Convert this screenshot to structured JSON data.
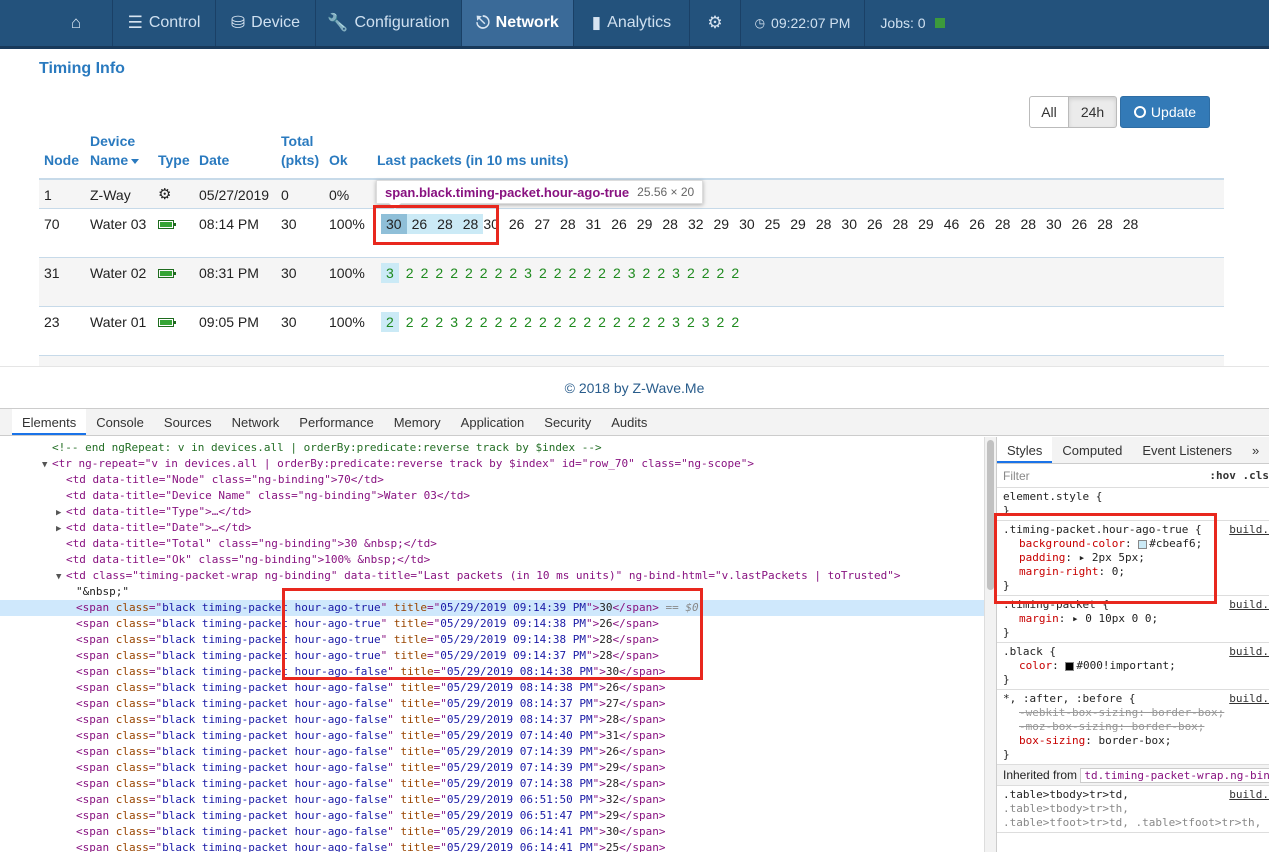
{
  "nav": {
    "items": [
      {
        "icon": "home-icon",
        "label": ""
      },
      {
        "icon": "sliders-icon",
        "label": "Control"
      },
      {
        "icon": "database-icon",
        "label": "Device"
      },
      {
        "icon": "wrench-icon",
        "label": "Configuration"
      },
      {
        "icon": "sitemap-icon",
        "label": "Network"
      },
      {
        "icon": "bar-chart-icon",
        "label": "Analytics"
      },
      {
        "icon": "gear-icon",
        "label": ""
      }
    ],
    "clock": "09:22:07 PM",
    "jobs": "Jobs: 0",
    "accent": "#23527c"
  },
  "page": {
    "title": "Timing Info",
    "filters": {
      "all": "All",
      "h24": "24h",
      "update": "Update"
    }
  },
  "table": {
    "headers": {
      "node": "Node",
      "device_name_1": "Device",
      "device_name_2": "Name",
      "type": "Type",
      "date": "Date",
      "total_1": "Total",
      "total_2": "(pkts)",
      "ok": "Ok",
      "last": "Last packets (in 10 ms units)"
    },
    "rows": [
      {
        "node": "1",
        "name": "Z-Way",
        "date": "05/27/2019",
        "total": "0",
        "ok": "0%"
      },
      {
        "node": "70",
        "name": "Water 03",
        "date": "08:14 PM",
        "total": "30",
        "ok": "100%"
      },
      {
        "node": "31",
        "name": "Water 02",
        "date": "08:31 PM",
        "total": "30",
        "ok": "100%"
      },
      {
        "node": "23",
        "name": "Water 01",
        "date": "09:05 PM",
        "total": "30",
        "ok": "100%"
      }
    ],
    "packets_70_hl": [
      "30",
      "26",
      "28",
      "28"
    ],
    "packets_70": [
      "30",
      "26",
      "27",
      "28",
      "31",
      "26",
      "29",
      "28",
      "32",
      "29",
      "30",
      "25",
      "29",
      "28",
      "30",
      "26",
      "28",
      "29",
      "46",
      "26",
      "28",
      "28",
      "30",
      "26",
      "28",
      "28"
    ],
    "packets_31_hl": [
      "3"
    ],
    "packets_31": [
      "2",
      "2",
      "2",
      "2",
      "2",
      "2",
      "2",
      "2",
      "3",
      "2",
      "2",
      "2",
      "2",
      "2",
      "2",
      "3",
      "2",
      "2",
      "3",
      "2",
      "2",
      "2",
      "2"
    ],
    "packets_23_hl": [
      "2"
    ],
    "packets_23": [
      "2",
      "2",
      "2",
      "3",
      "2",
      "2",
      "2",
      "2",
      "2",
      "2",
      "2",
      "2",
      "2",
      "2",
      "2",
      "2",
      "2",
      "2",
      "3",
      "2",
      "3",
      "2",
      "2"
    ]
  },
  "tooltip": {
    "selector": "span.black.timing-packet.hour-ago-true",
    "size": "25.56 × 20"
  },
  "footer": "© 2018 by Z-Wave.Me",
  "devtools": {
    "tabs": [
      "Elements",
      "Console",
      "Sources",
      "Network",
      "Performance",
      "Memory",
      "Application",
      "Security",
      "Audits"
    ],
    "comment": "<!-- end ngRepeat: v in devices.all | orderBy:predicate:reverse track by $index -->",
    "tr_open": "<tr ng-repeat=\"v in devices.all | orderBy:predicate:reverse track by $index\" id=\"row_70\" class=\"ng-scope\">",
    "td_lines": [
      "<td data-title=\"Node\" class=\"ng-binding\">70</td>",
      "<td data-title=\"Device Name\" class=\"ng-binding\">Water 03</td>",
      "<td data-title=\"Type\">…</td>",
      "<td data-title=\"Date\">…</td>",
      "<td data-title=\"Total\" class=\"ng-binding\">30 &nbsp;</td>",
      "<td data-title=\"Ok\" class=\"ng-binding\">100% &nbsp;</td>",
      "<td class=\"timing-packet-wrap ng-binding\" data-title=\"Last packets (in 10 ms units)\" ng-bind-html=\"v.lastPackets | toTrusted\">",
      "\"&nbsp;\""
    ],
    "spans": [
      {
        "cls": "black timing-packet hour-ago-true",
        "title": "05/29/2019 09:14:39 PM",
        "val": "30"
      },
      {
        "cls": "black timing-packet hour-ago-true",
        "title": "05/29/2019 09:14:38 PM",
        "val": "26"
      },
      {
        "cls": "black timing-packet hour-ago-true",
        "title": "05/29/2019 09:14:38 PM",
        "val": "28"
      },
      {
        "cls": "black timing-packet hour-ago-true",
        "title": "05/29/2019 09:14:37 PM",
        "val": "28"
      },
      {
        "cls": "black timing-packet hour-ago-false",
        "title": "05/29/2019 08:14:38 PM",
        "val": "30"
      },
      {
        "cls": "black timing-packet hour-ago-false",
        "title": "05/29/2019 08:14:38 PM",
        "val": "26"
      },
      {
        "cls": "black timing-packet hour-ago-false",
        "title": "05/29/2019 08:14:37 PM",
        "val": "27"
      },
      {
        "cls": "black timing-packet hour-ago-false",
        "title": "05/29/2019 08:14:37 PM",
        "val": "28"
      },
      {
        "cls": "black timing-packet hour-ago-false",
        "title": "05/29/2019 07:14:40 PM",
        "val": "31"
      },
      {
        "cls": "black timing-packet hour-ago-false",
        "title": "05/29/2019 07:14:39 PM",
        "val": "26"
      },
      {
        "cls": "black timing-packet hour-ago-false",
        "title": "05/29/2019 07:14:39 PM",
        "val": "29"
      },
      {
        "cls": "black timing-packet hour-ago-false",
        "title": "05/29/2019 07:14:38 PM",
        "val": "28"
      },
      {
        "cls": "black timing-packet hour-ago-false",
        "title": "05/29/2019 06:51:50 PM",
        "val": "32"
      },
      {
        "cls": "black timing-packet hour-ago-false",
        "title": "05/29/2019 06:51:47 PM",
        "val": "29"
      },
      {
        "cls": "black timing-packet hour-ago-false",
        "title": "05/29/2019 06:14:41 PM",
        "val": "30"
      },
      {
        "cls": "black timing-packet hour-ago-false",
        "title": "05/29/2019 06:14:41 PM",
        "val": "25"
      }
    ],
    "selected_marker": "== $0",
    "styles_tabs": [
      "Styles",
      "Computed",
      "Event Listeners",
      "»"
    ],
    "filter_placeholder": "Filter",
    "filter_opts": ":hov  .cls",
    "rules": {
      "element_style": "element.style {",
      "r1_sel": ".timing-packet.hour-ago-true {",
      "r1_src": "build.",
      "r1_p1n": "background-color",
      "r1_p1v": "#cbeaf6;",
      "r1_p2n": "padding",
      "r1_p2v": "2px 5px;",
      "r1_p3n": "margin-right",
      "r1_p3v": "0;",
      "r2_sel": ".timing-packet {",
      "r2_src": "build.",
      "r2_p1n": "margin",
      "r2_p1v": "0 10px 0 0;",
      "r3_sel": ".black {",
      "r3_src": "build.",
      "r3_p1n": "color",
      "r3_p1v": "#000!important;",
      "r4_sel": "*, :after, :before {",
      "r4_src": "build.",
      "r4_p1": "-webkit-box-sizing: border-box;",
      "r4_p2": "-moz-box-sizing: border-box;",
      "r4_p3n": "box-sizing",
      "r4_p3v": "border-box;",
      "close": "}",
      "inherited_label": "Inherited from",
      "inherited_target": "td.timing-packet-wrap.ng-bin",
      "r5_l1": ".table>tbody>tr>td,",
      "r5_l2": ".table>tbody>tr>th,",
      "r5_l3": ".table>tfoot>tr>td, .table>tfoot>tr>th,",
      "r5_src": "build."
    },
    "colors": {
      "swatch": "#cbeaf6",
      "black": "#000000"
    }
  }
}
